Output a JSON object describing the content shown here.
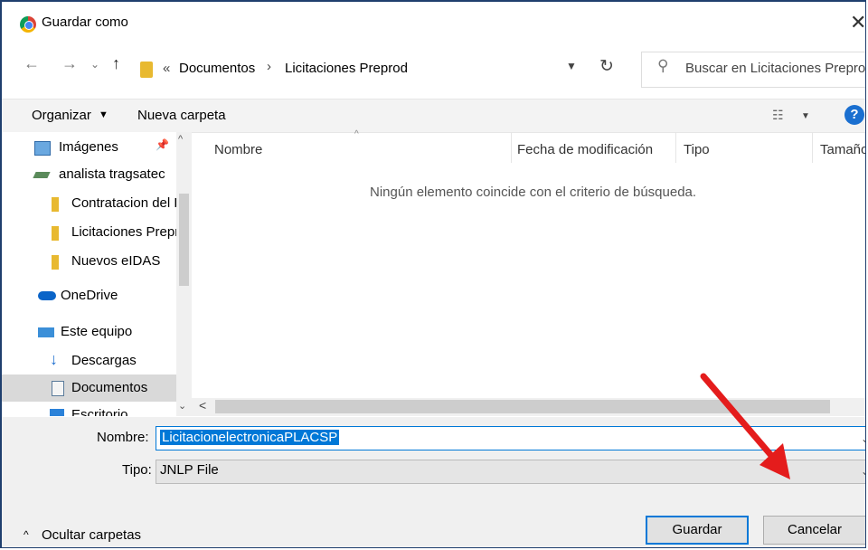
{
  "window": {
    "title": "Guardar como"
  },
  "address": {
    "chevrons": "«",
    "crumbs": [
      "Documentos",
      "Licitaciones Preprod"
    ],
    "separator": "›"
  },
  "search": {
    "placeholder": "Buscar en Licitaciones Preprod"
  },
  "toolbar": {
    "organize_label": "Organizar",
    "new_folder_label": "Nueva carpeta",
    "help_label": "?"
  },
  "sidebar": {
    "items": [
      {
        "label": "Imágenes",
        "icon": "pictures-icon"
      },
      {
        "label": "analista tragsatec",
        "icon": "network-drive-icon"
      },
      {
        "label": "Contratacion del Estado",
        "icon": "folder-icon"
      },
      {
        "label": "Licitaciones Preprod",
        "icon": "folder-icon"
      },
      {
        "label": "Nuevos eIDAS",
        "icon": "folder-icon"
      },
      {
        "label": "OneDrive",
        "icon": "onedrive-icon"
      },
      {
        "label": "Este equipo",
        "icon": "computer-icon"
      },
      {
        "label": "Descargas",
        "icon": "download-icon"
      },
      {
        "label": "Documentos",
        "icon": "documents-icon"
      },
      {
        "label": "Escritorio",
        "icon": "desktop-icon"
      }
    ]
  },
  "columns": [
    "Nombre",
    "Fecha de modificación",
    "Tipo",
    "Tamaño"
  ],
  "empty_message": "Ningún elemento coincide con el criterio de búsqueda.",
  "form": {
    "name_label": "Nombre:",
    "name_value": "LicitacionelectronicaPLACSP",
    "type_label": "Tipo:",
    "type_value": "JNLP File"
  },
  "footer": {
    "hide_folders_label": "Ocultar carpetas",
    "save_label": "Guardar",
    "cancel_label": "Cancelar"
  },
  "colors": {
    "accent": "#0078d7",
    "annotation_arrow": "#e41c1c",
    "folder": "#e8b930"
  }
}
